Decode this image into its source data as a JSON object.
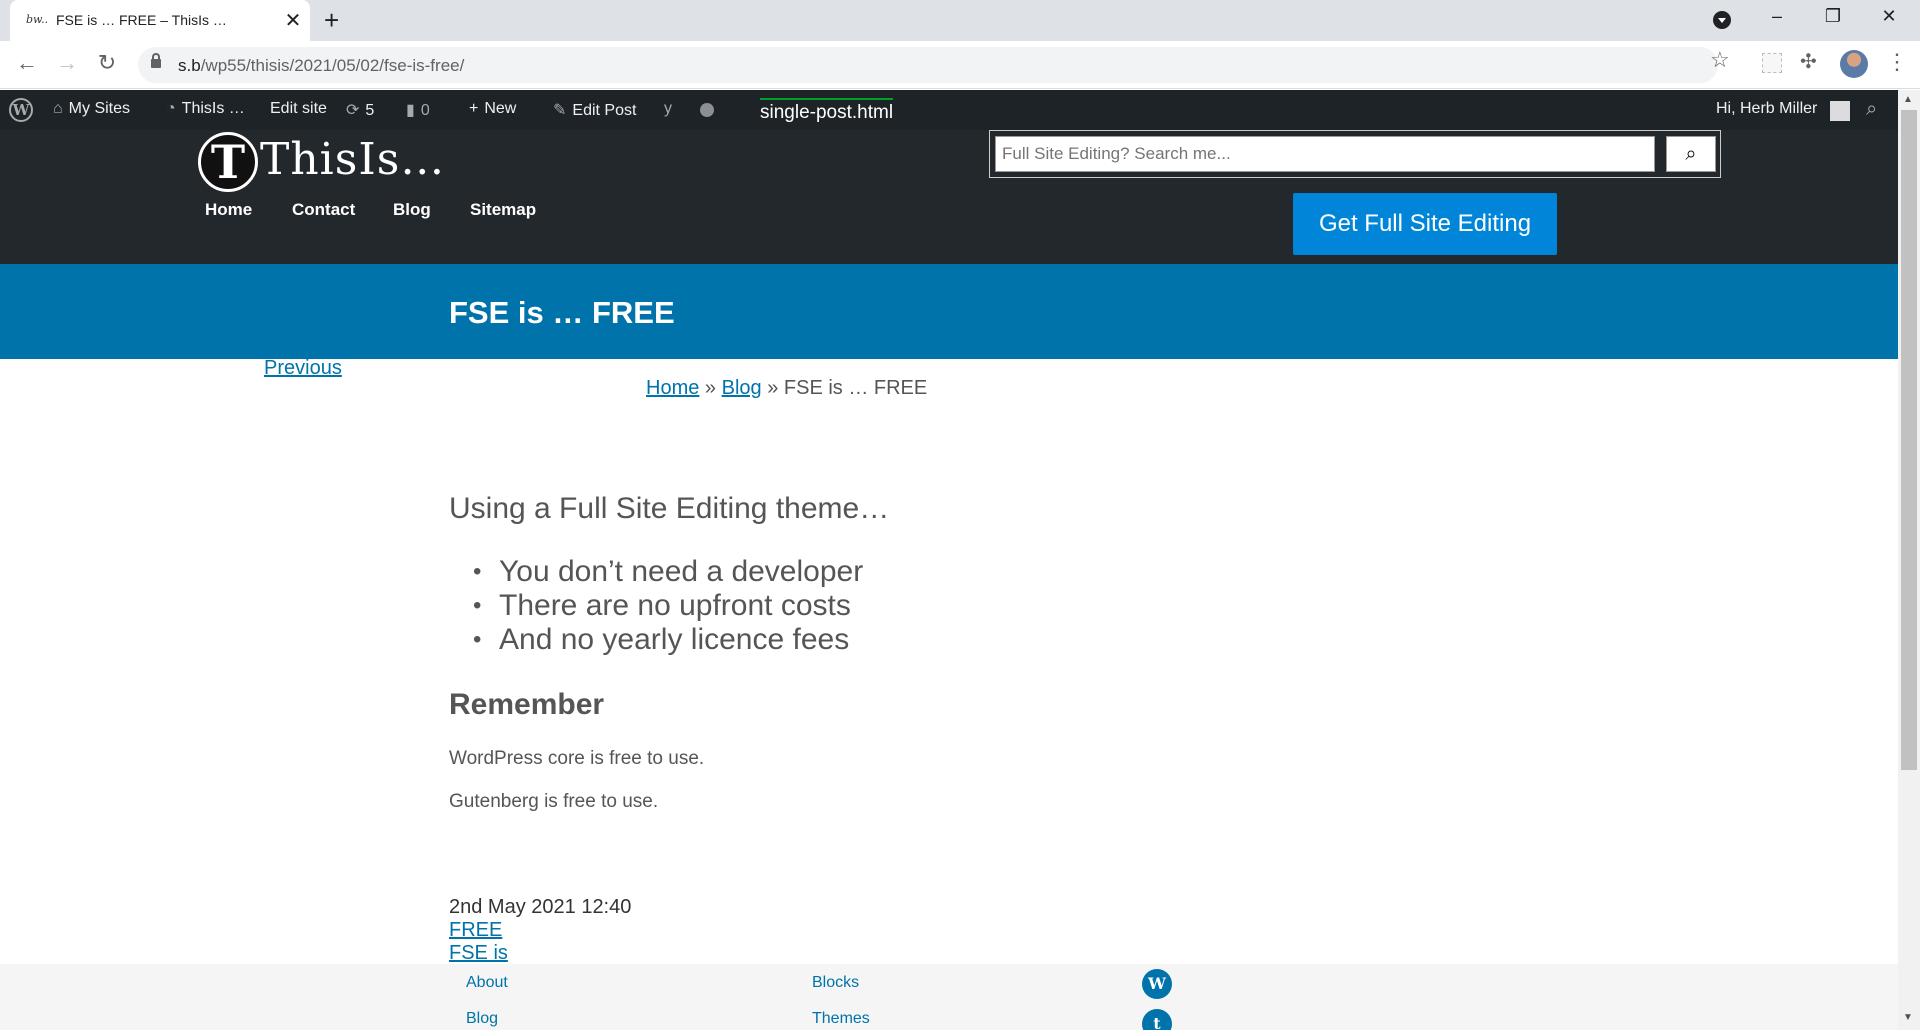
{
  "browser": {
    "tab_title": "FSE is … FREE – ThisIs …",
    "tab_favicon": "bw..",
    "url_host": "s.b",
    "url_path": "/wp55/thisis/2021/05/02/fse-is-free/"
  },
  "adminbar": {
    "my_sites": "My Sites",
    "site_name": "ThisIs …",
    "edit_site": "Edit site",
    "updates_count": "5",
    "comments_count": "0",
    "new": "New",
    "edit_post": "Edit Post",
    "greeting": "Hi, Herb Miller",
    "template_label": "single-post.html"
  },
  "site": {
    "logo_letter": "T",
    "title": "ThisIs…",
    "nav": [
      "Home",
      "Contact",
      "Blog",
      "Sitemap"
    ],
    "search_placeholder": "Full Site Editing? Search me...",
    "cta": "Get Full Site Editing"
  },
  "post": {
    "title": "FSE is … FREE",
    "previous": "Previous",
    "breadcrumb": {
      "home": "Home",
      "sep1": "»",
      "blog": "Blog",
      "sep2": "»",
      "current": "FSE is … FREE"
    },
    "intro": "Using a Full Site Editing theme…",
    "bullets": [
      "You don’t need a developer",
      "There are no upfront costs",
      "And no yearly licence fees"
    ],
    "heading": "Remember",
    "paragraphs": [
      "WordPress core is free to use.",
      "Gutenberg is free to use."
    ],
    "date": "2nd May 2021 12:40",
    "tags": [
      "FREE",
      "FSE is"
    ]
  },
  "footer": {
    "col1": [
      "About",
      "Blog"
    ],
    "col2": [
      "Blocks",
      "Themes"
    ],
    "icons": [
      "wordpress-icon",
      "twitter-icon"
    ]
  },
  "colors": {
    "admin_bar": "#1d2327",
    "header_bg": "#23282d",
    "title_band": "#0073aa",
    "cta": "#0085d8",
    "link": "#0073aa"
  }
}
